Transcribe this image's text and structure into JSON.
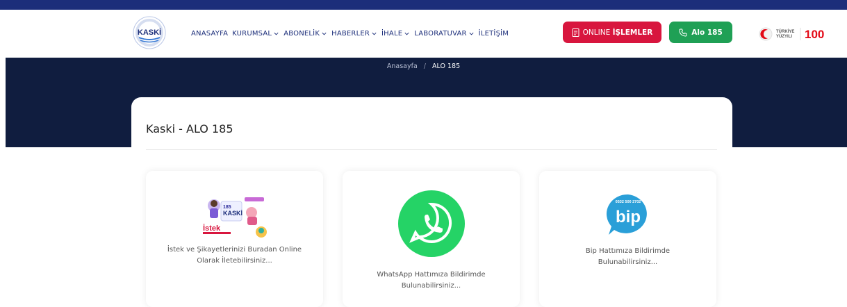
{
  "header": {
    "logo_text": "KASKİ",
    "nav": [
      {
        "label": "ANASAYFA",
        "dropdown": false
      },
      {
        "label": "KURUMSAL",
        "dropdown": true
      },
      {
        "label": "ABONELİK",
        "dropdown": true
      },
      {
        "label": "HABERLER",
        "dropdown": true
      },
      {
        "label": "İHALE",
        "dropdown": true
      },
      {
        "label": "LABORATUVAR",
        "dropdown": true
      },
      {
        "label": "İLETİŞİM",
        "dropdown": false
      }
    ],
    "online_button": {
      "prefix": "ONLINE",
      "bold": "İŞLEMLER",
      "icon": "document-icon",
      "color": "#d8163e"
    },
    "alo_button": {
      "label": "Alo 185",
      "icon": "phone-icon",
      "color": "#1fa055"
    },
    "turkiye_logo": {
      "line1": "TÜRKİYE",
      "line2": "YÜZYILI",
      "badge": "100"
    }
  },
  "breadcrumb": {
    "home": "Anasayfa",
    "separator": "/",
    "current": "ALO 185"
  },
  "page": {
    "title": "Kaski - ALO 185"
  },
  "tiles": [
    {
      "text": "İstek ve Şikayetlerinizi Buradan Online Olarak İletebilirsiniz...",
      "image_text": "İstek",
      "badge": "185",
      "brand": "KASKİ"
    },
    {
      "text": "WhatsApp Hattımıza Bildirimde Bulunabilirsiniz...",
      "icon": "whatsapp-icon",
      "color": "#25d366"
    },
    {
      "text": "Bip Hattımıza Bildirimde Bulunabilirsiniz...",
      "icon": "bip-icon",
      "phone": "0532 500 2702",
      "brand": "bip",
      "color": "#2a9fd8"
    }
  ],
  "colors": {
    "navy": "#1c2e7a",
    "hero": "#101d3f"
  }
}
